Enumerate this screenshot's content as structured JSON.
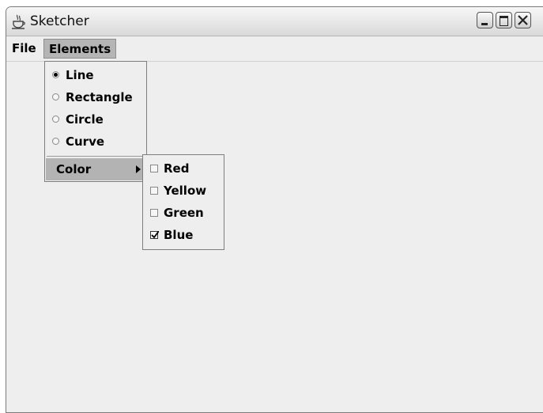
{
  "window": {
    "title": "Sketcher",
    "app_icon": "java-coffee-cup-icon",
    "controls": [
      "minimize-icon",
      "maximize-icon",
      "close-icon"
    ]
  },
  "menubar": {
    "items": [
      {
        "label": "File"
      },
      {
        "label": "Elements"
      }
    ]
  },
  "elements_menu": {
    "items": [
      {
        "label": "Line",
        "selected": true
      },
      {
        "label": "Rectangle",
        "selected": false
      },
      {
        "label": "Circle",
        "selected": false
      },
      {
        "label": "Curve",
        "selected": false
      }
    ],
    "color_item": {
      "label": "Color"
    }
  },
  "color_menu": {
    "items": [
      {
        "label": "Red",
        "checked": false
      },
      {
        "label": "Yellow",
        "checked": false
      },
      {
        "label": "Green",
        "checked": false
      },
      {
        "label": "Blue",
        "checked": true
      }
    ]
  }
}
